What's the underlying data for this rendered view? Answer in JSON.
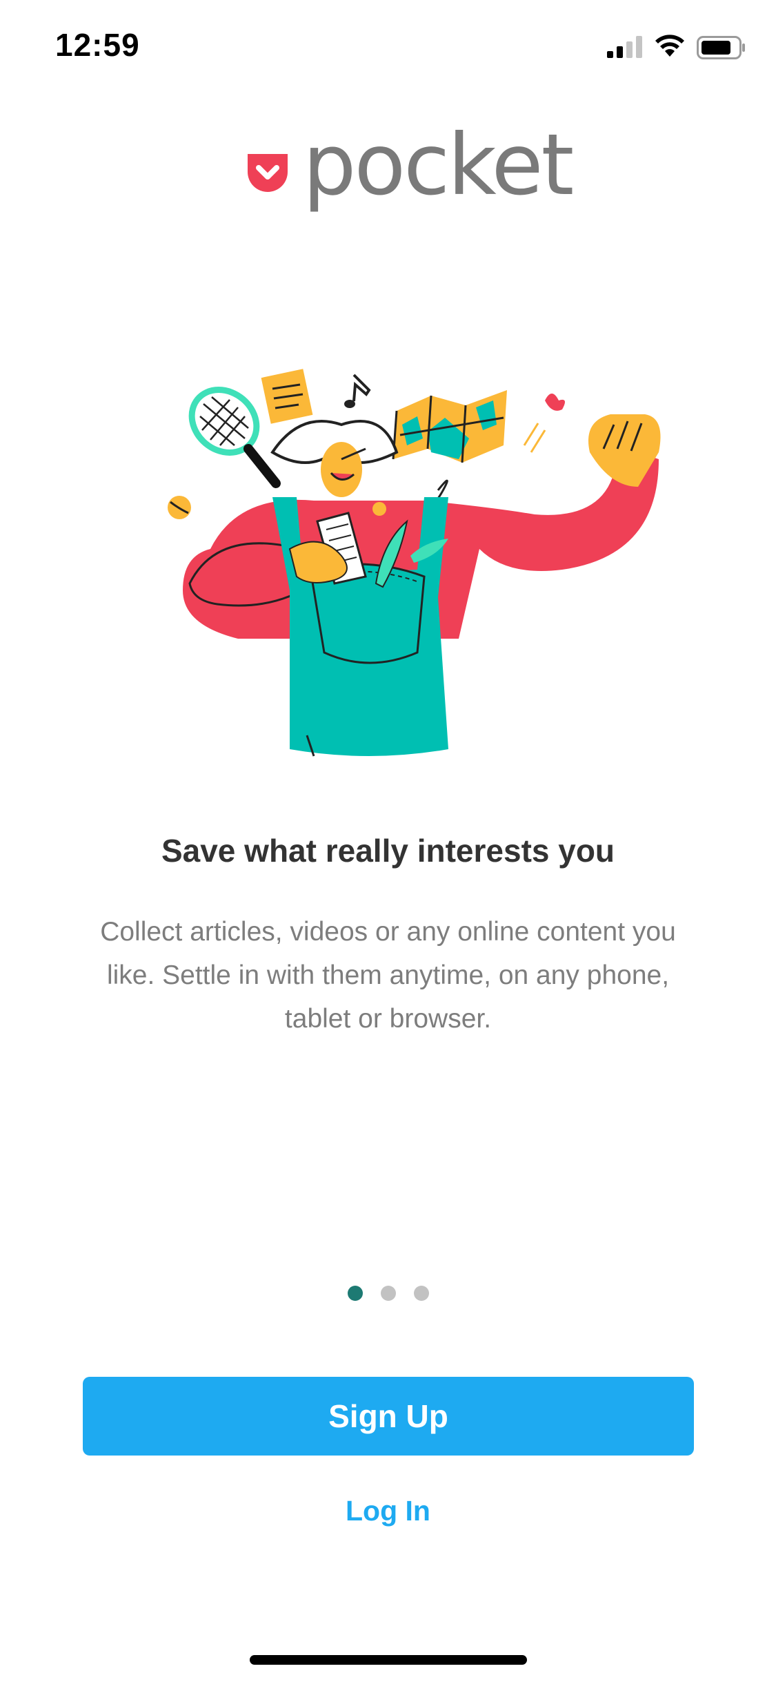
{
  "status_bar": {
    "time": "12:59",
    "icons": [
      "signal-icon",
      "wifi-icon",
      "battery-icon"
    ]
  },
  "logo": {
    "text": "pocket",
    "icon": "pocket-logo-icon",
    "brand_color": "#ef4056"
  },
  "illustration": {
    "icon": "person-with-pocket-illustration"
  },
  "onboarding": {
    "headline": "Save what really interests you",
    "description": "Collect articles, videos or any online content you like. Settle in with them anytime, on any phone, tablet or browser.",
    "pages": 3,
    "current_page": 1
  },
  "actions": {
    "signup_label": "Sign Up",
    "login_label": "Log In"
  },
  "colors": {
    "accent": "#1eaaf1",
    "dot_active": "#1d7a73",
    "dot_inactive": "#c2c2c2",
    "headline": "#333333",
    "body_text": "#7d7d7d"
  }
}
